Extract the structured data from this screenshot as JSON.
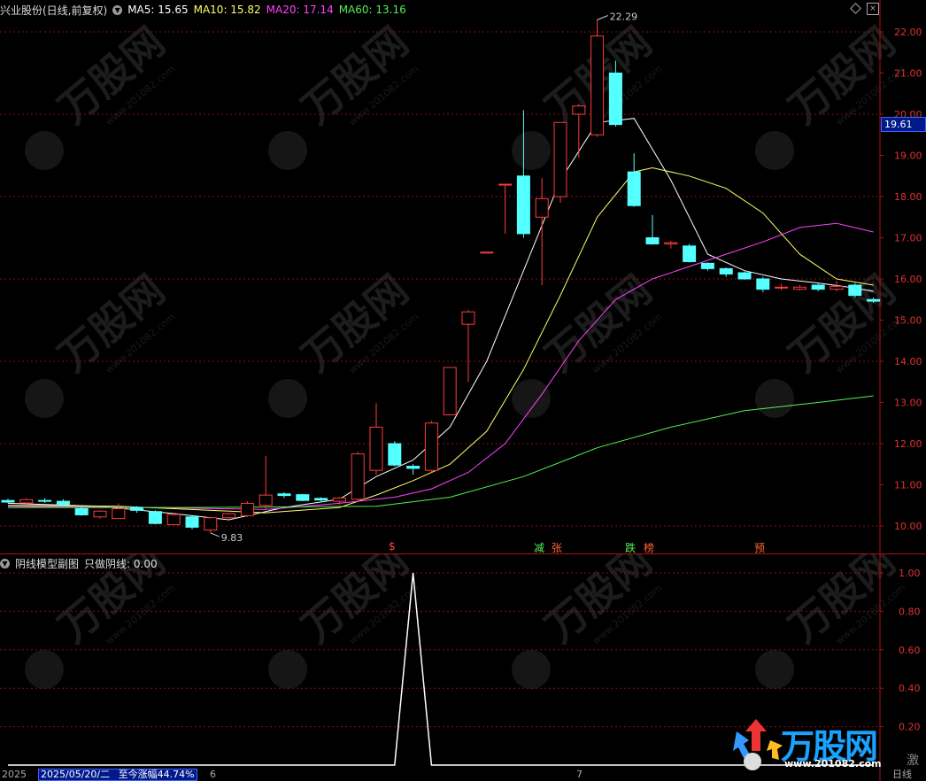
{
  "main": {
    "stock_label": "兴业股份(日线,前复权)",
    "ma": [
      {
        "label": "MA5: 15.65",
        "color": "#ffffff"
      },
      {
        "label": "MA10: 15.82",
        "color": "#ffff66"
      },
      {
        "label": "MA20: 17.14",
        "color": "#ff44ff"
      },
      {
        "label": "MA60: 13.16",
        "color": "#55ee55"
      }
    ],
    "current_price": "19.61",
    "high_label": "22.29",
    "low_label": "9.83",
    "price_ticks": [
      "22.00",
      "21.00",
      "20.00",
      "19.00",
      "18.00",
      "17.00",
      "16.00",
      "15.00",
      "14.00",
      "13.00",
      "12.00",
      "11.00",
      "10.00"
    ],
    "signals": [
      {
        "text": "$",
        "color": "#ff4444"
      },
      {
        "text": "减",
        "color": "#55ee55"
      },
      {
        "text": "张",
        "color": "#ff6633"
      },
      {
        "text": "跌",
        "color": "#55ee55"
      },
      {
        "text": "榜",
        "color": "#ff6633"
      },
      {
        "text": "预",
        "color": "#ff6633"
      }
    ]
  },
  "sub": {
    "title": "阴线模型副图",
    "value_label": "只做阴线: 0.00",
    "ticks": [
      "1.00",
      "0.80",
      "0.60",
      "0.40",
      "0.20"
    ]
  },
  "status_bar": {
    "year": "2025",
    "date": "2025/05/20/二",
    "change": "至今涨幅44.74%",
    "month_a": "6",
    "month_b": "7",
    "period": "日线",
    "extra": "激"
  },
  "watermark": {
    "text": "万股网",
    "url": "www.201082.com"
  },
  "chart_data": {
    "type": "candlestick",
    "ylim": [
      9.6,
      22.6
    ],
    "candles": [
      {
        "o": 10.62,
        "h": 10.66,
        "l": 10.55,
        "c": 10.58
      },
      {
        "o": 10.56,
        "h": 10.68,
        "l": 10.5,
        "c": 10.64
      },
      {
        "o": 10.62,
        "h": 10.68,
        "l": 10.56,
        "c": 10.6
      },
      {
        "o": 10.6,
        "h": 10.65,
        "l": 10.48,
        "c": 10.52
      },
      {
        "o": 10.42,
        "h": 10.5,
        "l": 10.25,
        "c": 10.27
      },
      {
        "o": 10.22,
        "h": 10.38,
        "l": 10.18,
        "c": 10.36
      },
      {
        "o": 10.18,
        "h": 10.55,
        "l": 10.18,
        "c": 10.42
      },
      {
        "o": 10.45,
        "h": 10.48,
        "l": 10.32,
        "c": 10.38
      },
      {
        "o": 10.35,
        "h": 10.38,
        "l": 10.04,
        "c": 10.06
      },
      {
        "o": 10.03,
        "h": 10.32,
        "l": 10.02,
        "c": 10.28
      },
      {
        "o": 10.22,
        "h": 10.26,
        "l": 9.92,
        "c": 9.97
      },
      {
        "o": 9.9,
        "h": 10.22,
        "l": 9.83,
        "c": 10.2
      },
      {
        "o": 10.2,
        "h": 10.32,
        "l": 10.15,
        "c": 10.3
      },
      {
        "o": 10.25,
        "h": 10.6,
        "l": 10.22,
        "c": 10.55
      },
      {
        "o": 10.5,
        "h": 11.7,
        "l": 10.4,
        "c": 10.75
      },
      {
        "o": 10.78,
        "h": 10.82,
        "l": 10.68,
        "c": 10.74
      },
      {
        "o": 10.76,
        "h": 10.78,
        "l": 10.6,
        "c": 10.62
      },
      {
        "o": 10.67,
        "h": 10.7,
        "l": 10.6,
        "c": 10.63
      },
      {
        "o": 10.6,
        "h": 10.7,
        "l": 10.52,
        "c": 10.68
      },
      {
        "o": 10.65,
        "h": 11.8,
        "l": 10.6,
        "c": 11.75
      },
      {
        "o": 11.35,
        "h": 12.98,
        "l": 11.25,
        "c": 12.4
      },
      {
        "o": 12.0,
        "h": 12.06,
        "l": 11.45,
        "c": 11.48
      },
      {
        "o": 11.45,
        "h": 11.5,
        "l": 11.25,
        "c": 11.4
      },
      {
        "o": 11.35,
        "h": 12.55,
        "l": 11.3,
        "c": 12.5
      },
      {
        "o": 12.7,
        "h": 13.85,
        "l": 12.7,
        "c": 13.85
      },
      {
        "o": 14.9,
        "h": 15.25,
        "l": 13.5,
        "c": 15.2
      },
      {
        "o": 16.65,
        "h": 16.65,
        "l": 16.65,
        "c": 16.65
      },
      {
        "o": 18.3,
        "h": 18.3,
        "l": 17.1,
        "c": 18.3
      },
      {
        "o": 18.5,
        "h": 20.1,
        "l": 17.0,
        "c": 17.1
      },
      {
        "o": 17.5,
        "h": 18.45,
        "l": 15.85,
        "c": 17.95
      },
      {
        "o": 18.0,
        "h": 19.5,
        "l": 17.85,
        "c": 19.8
      },
      {
        "o": 20.0,
        "h": 20.25,
        "l": 18.95,
        "c": 20.2
      },
      {
        "o": 19.5,
        "h": 22.29,
        "l": 19.45,
        "c": 21.9
      },
      {
        "o": 21.0,
        "h": 21.3,
        "l": 19.7,
        "c": 19.75
      },
      {
        "o": 18.6,
        "h": 19.05,
        "l": 17.75,
        "c": 17.78
      },
      {
        "o": 17.0,
        "h": 17.55,
        "l": 16.83,
        "c": 16.85
      },
      {
        "o": 16.85,
        "h": 16.92,
        "l": 16.74,
        "c": 16.88
      },
      {
        "o": 16.8,
        "h": 16.85,
        "l": 16.4,
        "c": 16.42
      },
      {
        "o": 16.38,
        "h": 16.4,
        "l": 16.2,
        "c": 16.25
      },
      {
        "o": 16.25,
        "h": 16.28,
        "l": 16.05,
        "c": 16.12
      },
      {
        "o": 16.15,
        "h": 16.18,
        "l": 15.98,
        "c": 16.0
      },
      {
        "o": 16.0,
        "h": 16.05,
        "l": 15.68,
        "c": 15.75
      },
      {
        "o": 15.8,
        "h": 15.88,
        "l": 15.72,
        "c": 15.8
      },
      {
        "o": 15.75,
        "h": 15.85,
        "l": 15.72,
        "c": 15.8
      },
      {
        "o": 15.85,
        "h": 15.88,
        "l": 15.7,
        "c": 15.75
      },
      {
        "o": 15.75,
        "h": 15.95,
        "l": 15.7,
        "c": 15.82
      },
      {
        "o": 15.85,
        "h": 15.9,
        "l": 15.55,
        "c": 15.6
      },
      {
        "o": 15.5,
        "h": 15.55,
        "l": 15.42,
        "c": 15.46
      }
    ],
    "ma_lines": [
      {
        "name": "MA5",
        "color": "#ffffff",
        "points": [
          [
            0,
            10.55
          ],
          [
            5,
            10.48
          ],
          [
            9,
            10.3
          ],
          [
            12,
            10.15
          ],
          [
            15,
            10.45
          ],
          [
            18,
            10.65
          ],
          [
            20,
            11.2
          ],
          [
            22,
            11.6
          ],
          [
            24,
            12.4
          ],
          [
            26,
            14.0
          ],
          [
            28,
            16.2
          ],
          [
            30,
            18.4
          ],
          [
            32,
            19.8
          ],
          [
            34,
            19.9
          ],
          [
            36,
            18.4
          ],
          [
            38,
            16.6
          ],
          [
            40,
            16.2
          ],
          [
            42,
            16.0
          ],
          [
            44,
            15.9
          ],
          [
            46,
            15.78
          ],
          [
            47,
            15.7
          ]
        ]
      },
      {
        "name": "MA10",
        "color": "#ffff66",
        "points": [
          [
            0,
            10.5
          ],
          [
            6,
            10.48
          ],
          [
            10,
            10.4
          ],
          [
            14,
            10.32
          ],
          [
            18,
            10.45
          ],
          [
            20,
            10.75
          ],
          [
            22,
            11.1
          ],
          [
            24,
            11.5
          ],
          [
            26,
            12.3
          ],
          [
            28,
            13.8
          ],
          [
            30,
            15.6
          ],
          [
            32,
            17.5
          ],
          [
            34,
            18.6
          ],
          [
            35,
            18.7
          ],
          [
            37,
            18.5
          ],
          [
            39,
            18.2
          ],
          [
            41,
            17.6
          ],
          [
            43,
            16.6
          ],
          [
            45,
            16.0
          ],
          [
            47,
            15.85
          ]
        ]
      },
      {
        "name": "MA20",
        "color": "#ff44ff",
        "points": [
          [
            0,
            10.48
          ],
          [
            8,
            10.45
          ],
          [
            14,
            10.4
          ],
          [
            18,
            10.55
          ],
          [
            21,
            10.7
          ],
          [
            23,
            10.9
          ],
          [
            25,
            11.3
          ],
          [
            27,
            12.0
          ],
          [
            29,
            13.2
          ],
          [
            31,
            14.5
          ],
          [
            33,
            15.5
          ],
          [
            35,
            16.0
          ],
          [
            37,
            16.3
          ],
          [
            39,
            16.6
          ],
          [
            41,
            16.9
          ],
          [
            43,
            17.25
          ],
          [
            45,
            17.35
          ],
          [
            47,
            17.14
          ]
        ]
      },
      {
        "name": "MA60",
        "color": "#55ee55",
        "points": [
          [
            0,
            10.45
          ],
          [
            10,
            10.45
          ],
          [
            20,
            10.48
          ],
          [
            24,
            10.7
          ],
          [
            28,
            11.2
          ],
          [
            32,
            11.9
          ],
          [
            36,
            12.4
          ],
          [
            40,
            12.8
          ],
          [
            44,
            13.0
          ],
          [
            47,
            13.16
          ]
        ]
      }
    ],
    "sub_ylim": [
      0,
      1.05
    ],
    "sub_series": {
      "name": "只做阴线",
      "values": [
        0,
        0,
        0,
        0,
        0,
        0,
        0,
        0,
        0,
        0,
        0,
        0,
        0,
        0,
        0,
        0,
        0,
        0,
        0,
        0,
        0,
        0,
        1,
        0,
        0,
        0,
        0,
        0,
        0,
        0,
        0,
        0,
        0,
        0,
        0,
        0,
        0,
        0,
        0,
        0,
        0,
        0,
        0,
        0,
        0,
        0,
        0,
        0
      ]
    }
  }
}
